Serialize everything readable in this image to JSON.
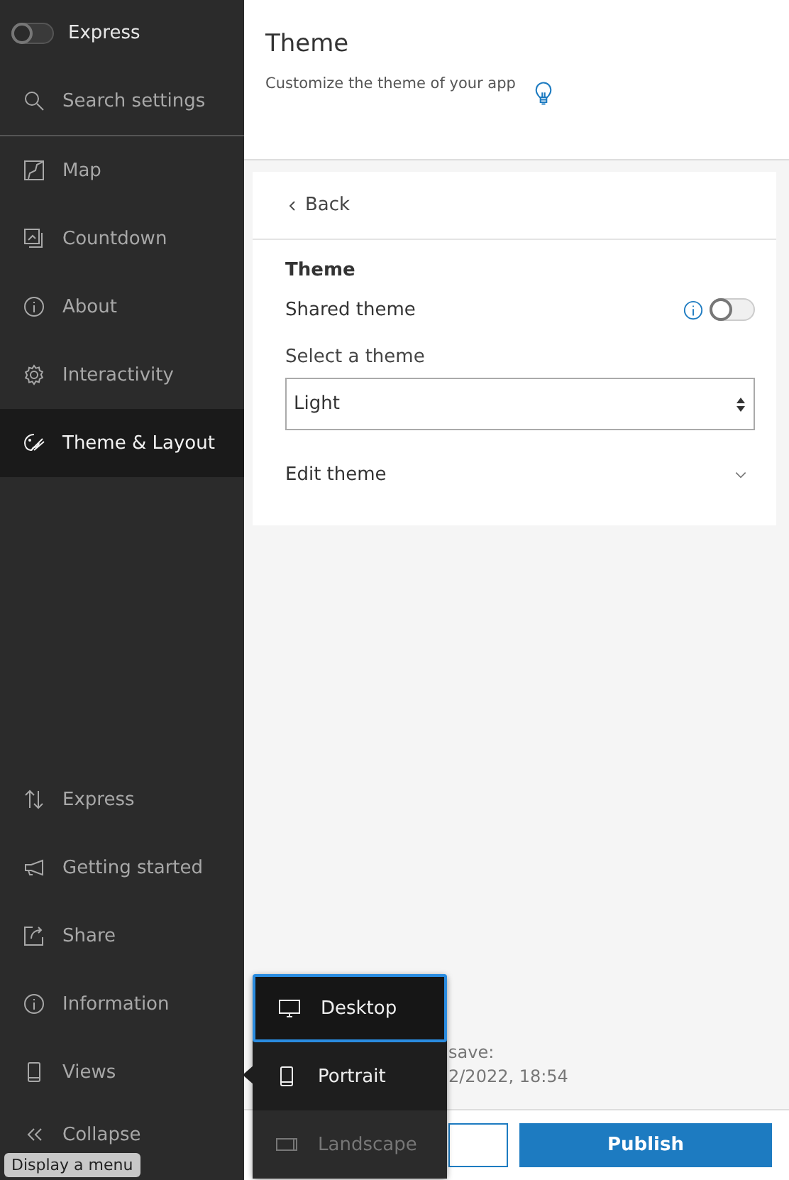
{
  "sidebar": {
    "express_toggle": {
      "label": "Express",
      "on": false
    },
    "search": {
      "placeholder": "Search settings"
    },
    "items": [
      {
        "kind": "map",
        "label": "Map",
        "selected": false
      },
      {
        "kind": "countdown",
        "label": "Countdown",
        "selected": false
      },
      {
        "kind": "info",
        "label": "About",
        "selected": false
      },
      {
        "kind": "gear",
        "label": "Interactivity",
        "selected": false
      },
      {
        "kind": "palette",
        "label": "Theme & Layout",
        "selected": true
      }
    ],
    "bottom_items": [
      {
        "kind": "arrows",
        "label": "Express"
      },
      {
        "kind": "megaphone",
        "label": "Getting started"
      },
      {
        "kind": "share",
        "label": "Share"
      },
      {
        "kind": "info",
        "label": "Information"
      },
      {
        "kind": "phone",
        "label": "Views"
      },
      {
        "kind": "collapse",
        "label": "Collapse"
      }
    ]
  },
  "header": {
    "title": "Theme",
    "subtitle": "Customize the theme of your app"
  },
  "panel": {
    "back": "Back",
    "section_title": "Theme",
    "shared_theme": {
      "label": "Shared theme",
      "on": false
    },
    "select": {
      "label": "Select a theme",
      "value": "Light"
    },
    "edit_theme": {
      "label": "Edit theme",
      "expanded": false
    }
  },
  "footer": {
    "save_lines": [
      "save:",
      "2/2022, 18:54"
    ],
    "publish": "Publish"
  },
  "views_menu": [
    {
      "kind": "desktop",
      "label": "Desktop",
      "selected": true,
      "disabled": false
    },
    {
      "kind": "phone",
      "label": "Portrait",
      "selected": false,
      "disabled": false
    },
    {
      "kind": "landscape",
      "label": "Landscape",
      "selected": false,
      "disabled": true
    }
  ],
  "tooltip": "Display a menu"
}
